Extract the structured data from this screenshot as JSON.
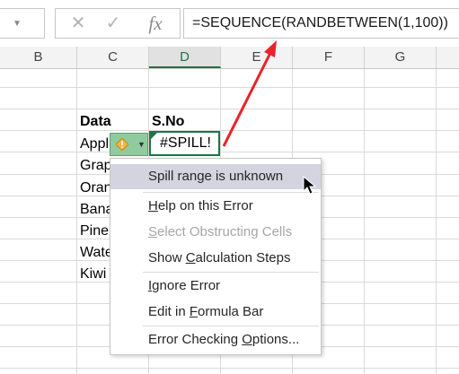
{
  "formula_bar": {
    "cancel_icon": "x-icon",
    "enter_icon": "check-icon",
    "fx_label": "fx",
    "formula": "=SEQUENCE(RANDBETWEEN(1,100))"
  },
  "columns": [
    "B",
    "C",
    "D",
    "E",
    "F",
    "G"
  ],
  "selected_column": "D",
  "cells": {
    "c_header": "Data",
    "d_header": "S.No",
    "c_values": [
      "Appl",
      "Grap",
      "Oran",
      "Bana",
      "Pine",
      "Wate",
      "Kiwi"
    ],
    "active_value": "#SPILL!"
  },
  "error_menu": {
    "title": "Spill range is unknown",
    "items": [
      {
        "pre": "",
        "key": "H",
        "post": "elp on this Error"
      },
      {
        "pre": "",
        "key": "S",
        "post": "elect Obstructing Cells"
      },
      {
        "pre": "Show ",
        "key": "C",
        "post": "alculation Steps"
      },
      {
        "pre": "",
        "key": "I",
        "post": "gnore Error"
      },
      {
        "pre": "Edit in ",
        "key": "F",
        "post": "ormula Bar"
      },
      {
        "pre": "Error Checking ",
        "key": "O",
        "post": "ptions..."
      }
    ]
  },
  "colors": {
    "accent_green": "#217346",
    "arrow_red": "#e8232a",
    "menu_highlight": "#d4d4e0"
  }
}
